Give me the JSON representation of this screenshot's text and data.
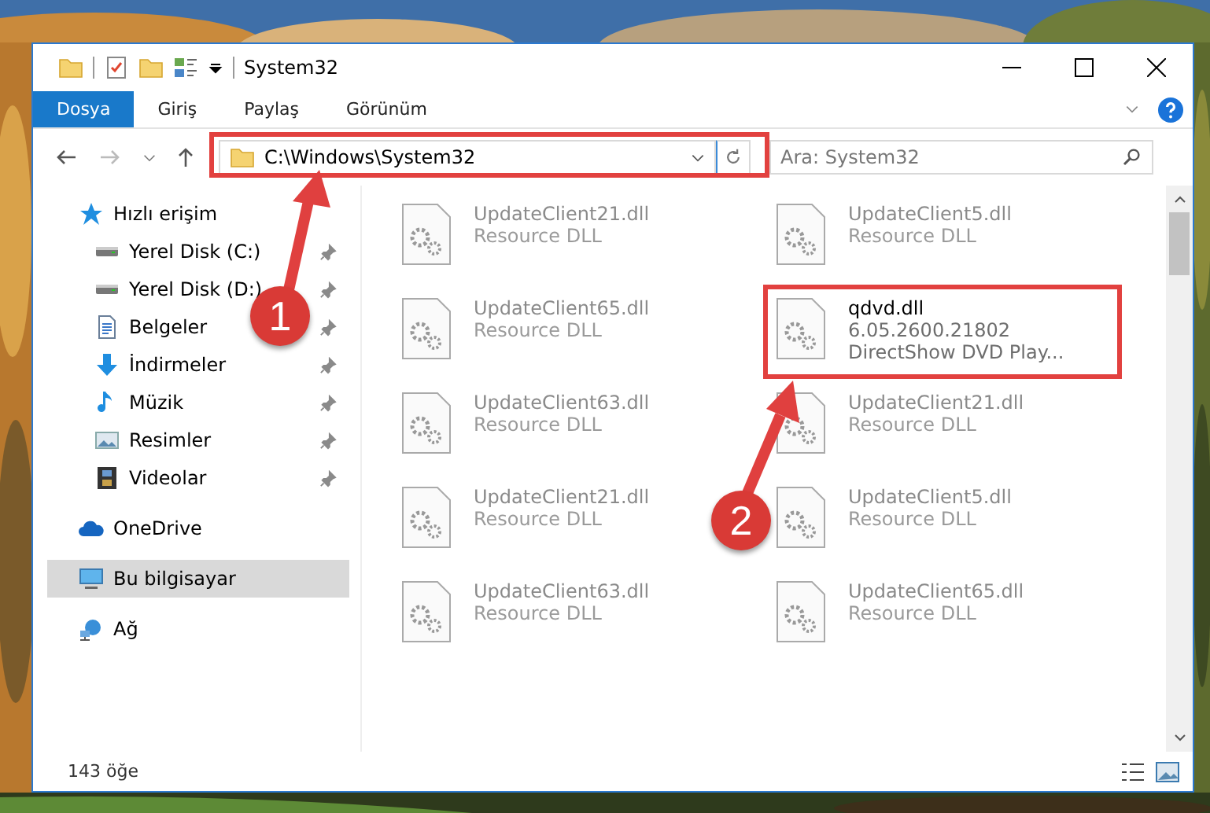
{
  "window": {
    "title": "System32"
  },
  "quick_access_toolbar": {
    "has_dropdown": true
  },
  "ribbon_tabs": [
    {
      "label": "Dosya",
      "selected": true
    },
    {
      "label": "Giriş",
      "selected": false
    },
    {
      "label": "Paylaş",
      "selected": false
    },
    {
      "label": "Görünüm",
      "selected": false
    }
  ],
  "address": {
    "path": "C:\\Windows\\System32"
  },
  "search": {
    "placeholder": "Ara: System32"
  },
  "sidebar": {
    "items": [
      {
        "label": "Hızlı erişim",
        "kind": "star",
        "selected": false,
        "children": [
          {
            "label": "Yerel Disk (C:)",
            "kind": "drive",
            "pinned": true,
            "selected": false
          },
          {
            "label": "Yerel Disk (D:)",
            "kind": "drive",
            "pinned": true,
            "selected": false
          },
          {
            "label": "Belgeler",
            "kind": "docs",
            "pinned": true,
            "selected": false
          },
          {
            "label": "İndirmeler",
            "kind": "download",
            "pinned": true,
            "selected": false
          },
          {
            "label": "Müzik",
            "kind": "music",
            "pinned": true,
            "selected": false
          },
          {
            "label": "Resimler",
            "kind": "pictures",
            "pinned": true,
            "selected": false
          },
          {
            "label": "Videolar",
            "kind": "video",
            "pinned": true,
            "selected": false
          }
        ]
      },
      {
        "label": "OneDrive",
        "kind": "cloud",
        "selected": false
      },
      {
        "label": "Bu bilgisayar",
        "kind": "computer",
        "selected": true
      },
      {
        "label": "Ağ",
        "kind": "network",
        "selected": false
      }
    ]
  },
  "files": [
    {
      "name": "UpdateClient21.dll",
      "details": [
        "Resource DLL"
      ],
      "dimmed": true
    },
    {
      "name": "UpdateClient5.dll",
      "details": [
        "Resource DLL"
      ],
      "dimmed": true
    },
    {
      "name": "UpdateClient65.dll",
      "details": [
        "Resource DLL"
      ],
      "dimmed": true
    },
    {
      "name": "qdvd.dll",
      "details": [
        "6.05.2600.21802",
        "DirectShow DVD Play..."
      ],
      "dimmed": false
    },
    {
      "name": "UpdateClient63.dll",
      "details": [
        "Resource DLL"
      ],
      "dimmed": true
    },
    {
      "name": "UpdateClient21.dll",
      "details": [
        "Resource DLL"
      ],
      "dimmed": true
    },
    {
      "name": "UpdateClient21.dll",
      "details": [
        "Resource DLL"
      ],
      "dimmed": true
    },
    {
      "name": "UpdateClient5.dll",
      "details": [
        "Resource DLL"
      ],
      "dimmed": true
    },
    {
      "name": "UpdateClient63.dll",
      "details": [
        "Resource DLL"
      ],
      "dimmed": true
    },
    {
      "name": "UpdateClient65.dll",
      "details": [
        "Resource DLL"
      ],
      "dimmed": true
    }
  ],
  "status_bar": {
    "item_count": "143 öğe"
  },
  "annotations": [
    {
      "number": "1"
    },
    {
      "number": "2"
    }
  ]
}
